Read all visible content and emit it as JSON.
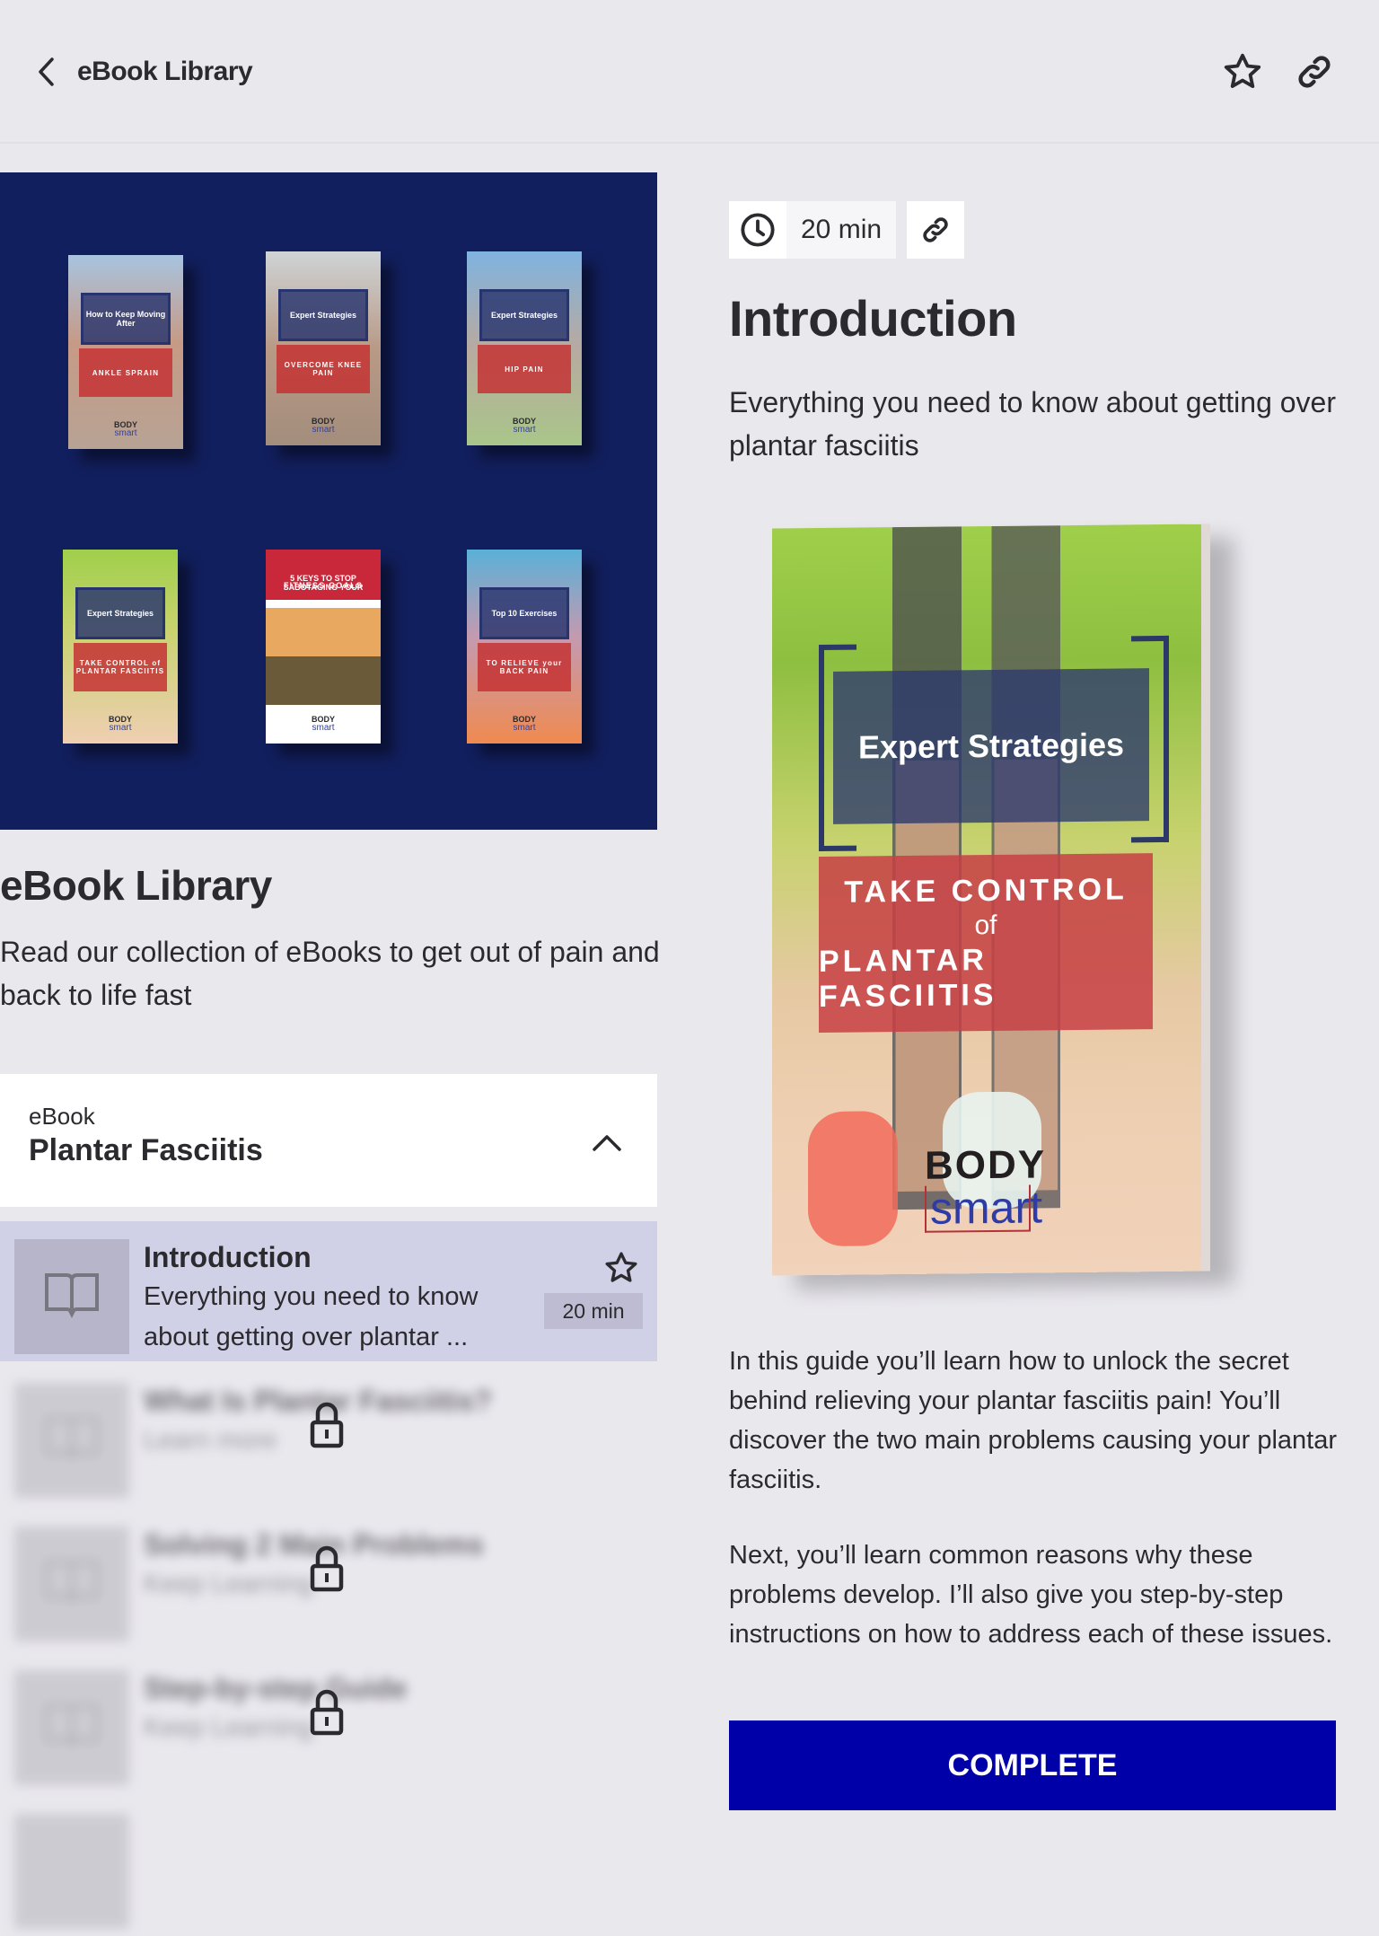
{
  "header": {
    "title": "eBook Library",
    "icons": {
      "back": "chevron-left-icon",
      "favorite": "star-outline-icon",
      "share": "link-icon"
    }
  },
  "library": {
    "title": "eBook Library",
    "description": "Read our collection of eBooks to get out of pain and back to life fast",
    "hero_books": [
      {
        "top": "How to Keep Moving After",
        "red": "ANKLE SPRAIN",
        "logo_top": "BODY",
        "logo_bottom": "smart"
      },
      {
        "top": "Expert Strategies",
        "red": "OVERCOME KNEE PAIN",
        "logo_top": "BODY",
        "logo_bottom": "smart"
      },
      {
        "top": "Expert Strategies",
        "red": "HIP PAIN",
        "logo_top": "BODY",
        "logo_bottom": "smart"
      },
      {
        "top": "Expert Strategies",
        "red": "TAKE CONTROL of PLANTAR FASCIITIS",
        "logo_top": "BODY",
        "logo_bottom": "smart"
      },
      {
        "top": "5 KEYS TO STOP SABOTAGING YOUR",
        "red": "FITNESS GOALS",
        "logo_top": "BODY",
        "logo_bottom": "smart"
      },
      {
        "top": "Top 10 Exercises",
        "red": "TO RELIEVE your BACK PAIN",
        "logo_top": "BODY",
        "logo_bottom": "smart"
      }
    ]
  },
  "section": {
    "label": "eBook",
    "title": "Plantar Fasciitis",
    "expanded": true
  },
  "lessons": [
    {
      "title": "Introduction",
      "description": "Everything you need to know about getting over plantar ...",
      "duration": "20 min",
      "locked": false,
      "active": true
    },
    {
      "title": "What Is Plantar Fasciitis?",
      "description": "Learn more",
      "locked": true
    },
    {
      "title": "Solving 2 Main Problems",
      "description": "Keep Learning",
      "locked": true
    },
    {
      "title": "Step-by-step Guide",
      "description": "Keep Learning",
      "locked": true
    }
  ],
  "detail": {
    "duration": "20 min",
    "title": "Introduction",
    "subtitle": "Everything you need to know about getting over plantar fasciitis",
    "cover": {
      "top_text": "Expert Strategies",
      "line1": "TAKE CONTROL",
      "line2": "of",
      "line3": "PLANTAR FASCIITIS",
      "logo_top": "BODY",
      "logo_bottom": "smart"
    },
    "paragraphs": [
      "In this guide you’ll learn how to unlock the secret behind relieving your plantar fasciitis pain! You’ll discover the two main problems causing your plantar fasciitis.",
      "Next, you’ll learn common reasons why these problems develop. I’ll also give you step-by-step instructions on how to address each of these issues."
    ],
    "complete_label": "COMPLETE"
  },
  "colors": {
    "background": "#e9e8ed",
    "hero_bg": "#121f5e",
    "active_item": "#d0d0e6",
    "primary_button": "#0000a8",
    "text": "#2b2a2e"
  }
}
